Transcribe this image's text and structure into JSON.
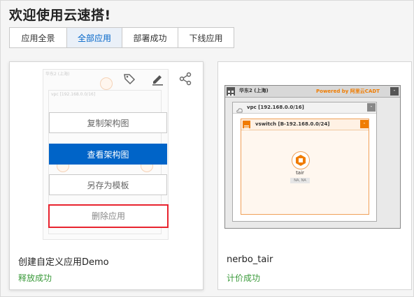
{
  "page": {
    "title": "欢迎使用云速搭!"
  },
  "tabs": [
    {
      "label": "应用全景",
      "active": false
    },
    {
      "label": "全部应用",
      "active": true
    },
    {
      "label": "部署成功",
      "active": false
    },
    {
      "label": "下线应用",
      "active": false
    }
  ],
  "cards": [
    {
      "name": "创建自定义应用Demo",
      "status": "释放成功",
      "status_color": "#3a9a3a",
      "thumbnail_ghost_texts": [
        "华东2 (上海)",
        "vpc [192.168.0.0/16]"
      ],
      "actions": {
        "copy": "复制架构图",
        "view": "查看架构图",
        "save_template": "另存为模板",
        "delete": "删除应用"
      },
      "tool_icons": [
        "tag-icon",
        "edit-icon",
        "share-icon"
      ]
    },
    {
      "name": "nerbo_tair",
      "status": "计价成功",
      "status_color": "#3a9a3a",
      "diagram": {
        "region": "华东2 (上海)",
        "powered_by": "Powered by 阿里云CADT",
        "vpc": "vpc [192.168.0.0/16]",
        "vswitch": "vswitch [B-192.168.0.0/24]",
        "node": "tair",
        "node_tag": "NA, NA"
      }
    }
  ],
  "colors": {
    "primary": "#0064c8",
    "danger_outline": "#e8232e",
    "status_green": "#3a9a3a",
    "cadt_orange": "#f07c00"
  }
}
